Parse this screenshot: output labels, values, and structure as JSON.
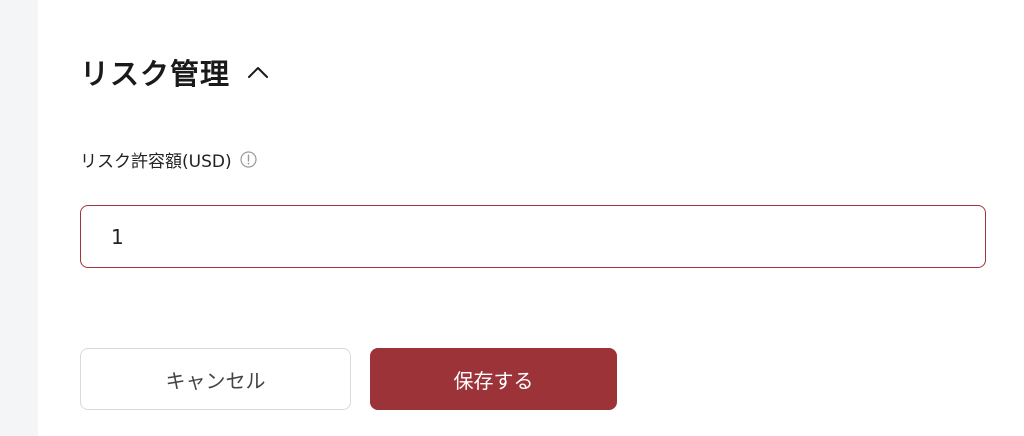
{
  "section": {
    "title": "リスク管理",
    "toggle_icon": "chevron-up-icon"
  },
  "risk_field": {
    "label": "リスク許容額(USD)",
    "info_icon": "info-circle-icon",
    "value": "1"
  },
  "actions": {
    "cancel_label": "キャンセル",
    "save_label": "保存する"
  },
  "colors": {
    "accent": "#9b3338",
    "input_border": "#a1343a",
    "sidebar_bg": "#f4f5f7"
  }
}
